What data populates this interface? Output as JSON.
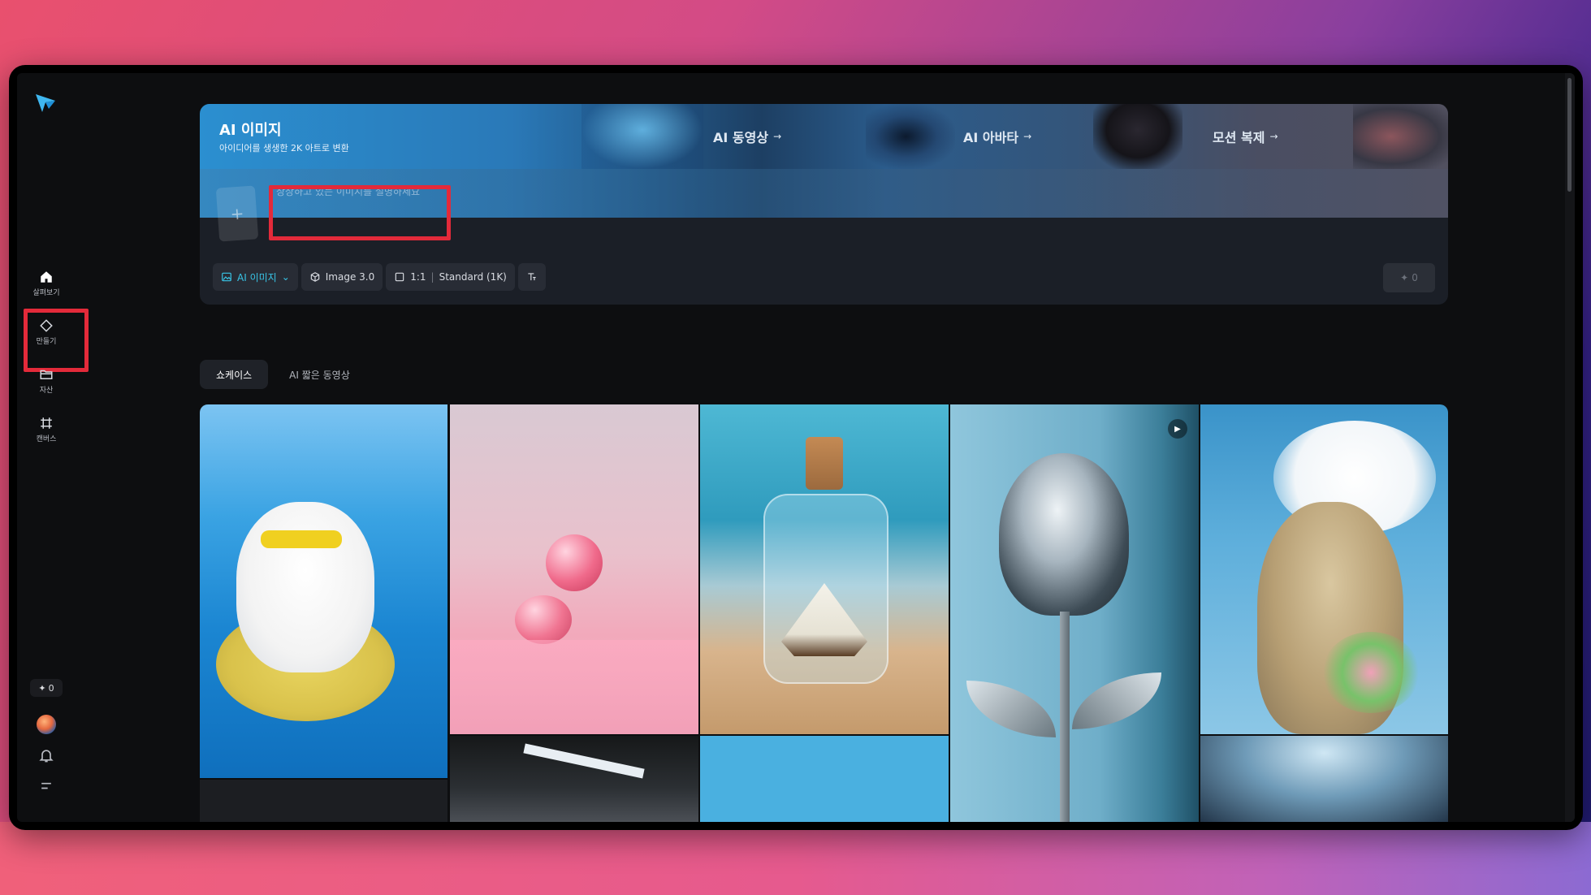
{
  "sidebar": {
    "logo_icon": "capcut-dreamina-logo",
    "items": [
      {
        "label": "살펴보기",
        "icon": "home-icon"
      },
      {
        "label": "만들기",
        "icon": "diamond-icon"
      },
      {
        "label": "자산",
        "icon": "folder-icon"
      },
      {
        "label": "캔버스",
        "icon": "canvas-icon"
      }
    ],
    "credits": "0",
    "avatar_icon": "avatar",
    "bell_icon": "bell-icon",
    "menu_icon": "menu-icon"
  },
  "hero": {
    "title": "AI 이미지",
    "subtitle": "아이디어를 생생한 2K 아트로 변환",
    "tabs": [
      {
        "label": "AI 동영상",
        "arrow": "→"
      },
      {
        "label": "AI 아바타",
        "arrow": "→"
      },
      {
        "label": "모션 복제",
        "arrow": "→"
      }
    ],
    "prompt_placeholder": "상상하고 있는 이미지를 설명하세요",
    "add_symbol": "+",
    "toolbar": {
      "mode": "AI 이미지",
      "model": "Image 3.0",
      "ratio": "1:1",
      "quality": "Standard (1K)"
    },
    "generate_credits": "0"
  },
  "gallery_tabs": [
    {
      "label": "쇼케이스",
      "active": true
    },
    {
      "label": "AI 짧은 동영상",
      "active": false
    }
  ],
  "colors": {
    "highlight": "#e32a3a",
    "accent": "#38c6e8",
    "app_bg": "#0d0e10"
  }
}
